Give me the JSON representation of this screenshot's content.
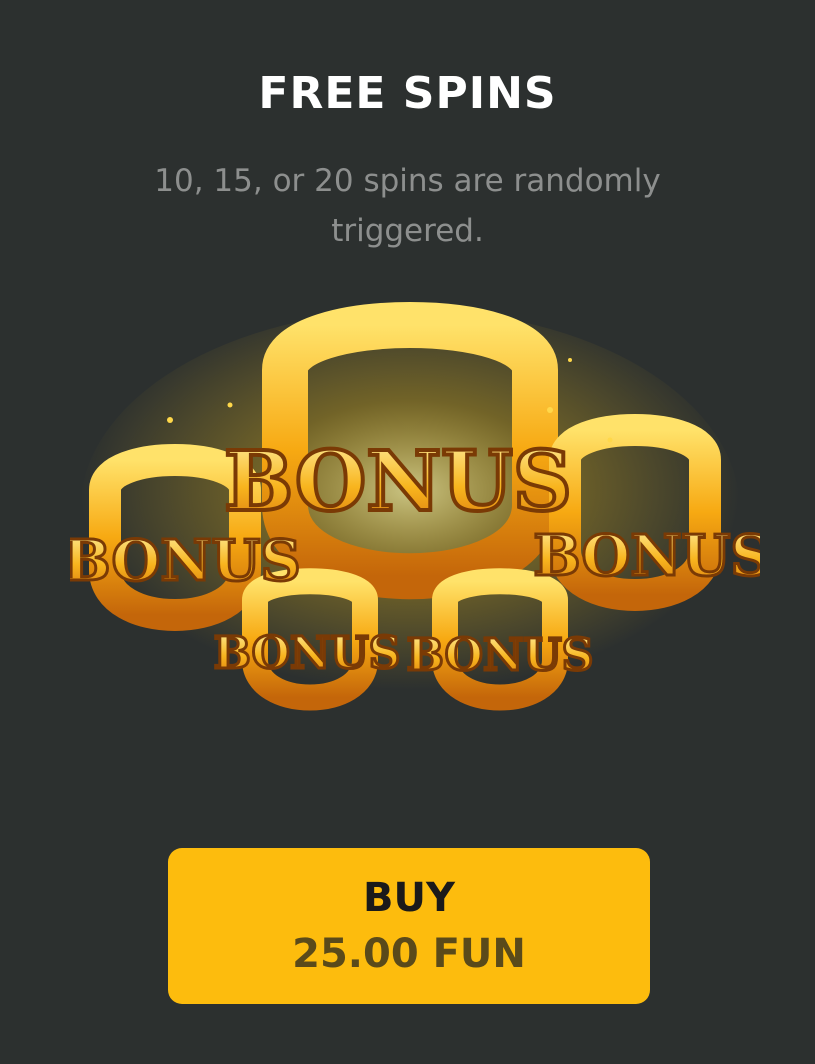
{
  "feature": {
    "title": "FREE SPINS",
    "description": "10, 15, or 20 spins are randomly triggered."
  },
  "artwork": {
    "icon": "horseshoe-bonus-icon",
    "labels": [
      "BONUS",
      "BONUS",
      "BONUS",
      "BONUS",
      "BONUS"
    ]
  },
  "buy_button": {
    "label": "BUY",
    "price": "25.00 FUN"
  },
  "colors": {
    "background": "#2c302f",
    "button": "#fdbc0d",
    "gold": "#f7a912"
  }
}
